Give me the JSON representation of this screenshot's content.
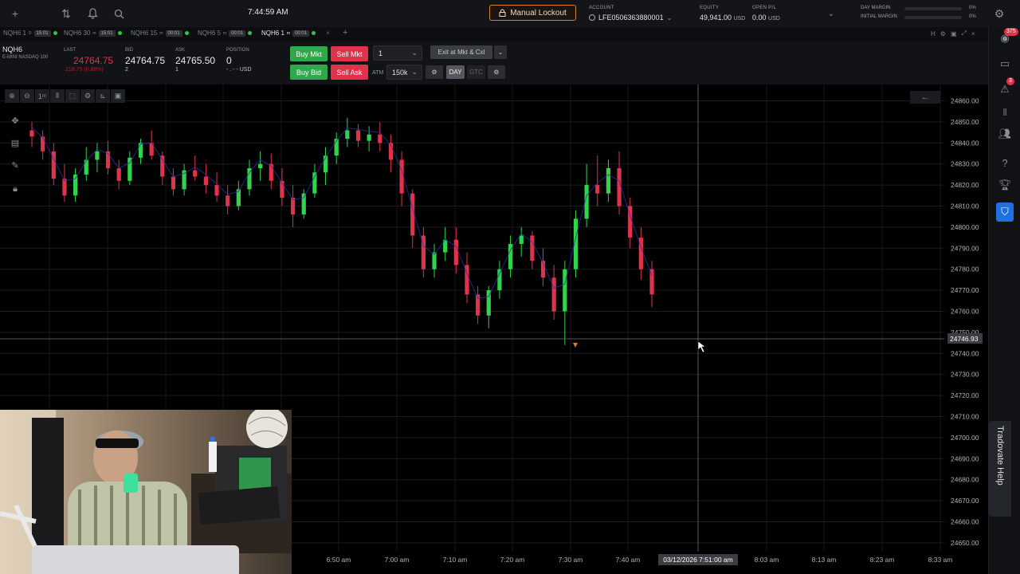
{
  "topbar": {
    "clock": "7:44:59 AM",
    "lockout_label": "Manual Lockout",
    "account_label": "ACCOUNT",
    "account_value": "LFE0506363880001",
    "equity_label": "EQUITY",
    "equity_value": "49,941.00",
    "equity_currency": "USD",
    "open_pl_label": "OPEN P/L",
    "open_pl_value": "0.00",
    "open_pl_currency": "USD",
    "day_margin_label": "DAY MARGIN",
    "day_margin_pct": "0%",
    "initial_margin_label": "INITIAL MARGIN",
    "initial_margin_pct": "0%"
  },
  "tabs": [
    {
      "label": "NQH6 1",
      "sup": "D",
      "tf": "15:01"
    },
    {
      "label": "NQH6 30",
      "sup": "m",
      "tf": "15:01"
    },
    {
      "label": "NQH6 15",
      "sup": "m",
      "tf": "00:01"
    },
    {
      "label": "NQH6 5",
      "sup": "m",
      "tf": "00:01"
    },
    {
      "label": "NQH6 1",
      "sup": "m",
      "tf": "00:01"
    }
  ],
  "quote": {
    "symbol": "NQH6",
    "description": "E-MINI NASDAQ 100",
    "last_label": "LAST",
    "last": "24764.75",
    "change": "218.75 (0.88%)",
    "bid_label": "BID",
    "bid": "24764.75",
    "bid_size": "2",
    "ask_label": "ASK",
    "ask": "24765.50",
    "ask_size": "1",
    "position_label": "POSITION",
    "position": "0",
    "position_sub": "- . - - USD"
  },
  "order": {
    "buy_mkt": "Buy Mkt",
    "sell_mkt": "Sell Mkt",
    "buy_bid": "Buy Bid",
    "sell_ask": "Sell Ask",
    "qty": "1",
    "atm_label": "ATM",
    "atm_value": "150k",
    "exit_label": "Exit at Mkt & Cxl",
    "day_label": "DAY",
    "gtc_label": "GTC"
  },
  "chart": {
    "crosshair_time": "03/12/2026 7:51:00 am",
    "crosshair_price": "24746.93",
    "x_ticks": [
      "6:50 am",
      "7:00 am",
      "7:10 am",
      "7:20 am",
      "7:30 am",
      "7:40 am",
      "8:03 am",
      "8:13 am",
      "8:23 am",
      "8:33 am"
    ],
    "y_ticks": [
      "24860.00",
      "24850.00",
      "24840.00",
      "24830.00",
      "24820.00",
      "24810.00",
      "24800.00",
      "24790.00",
      "24780.00",
      "24770.00",
      "24760.00",
      "24750.00",
      "24740.00",
      "24730.00",
      "24720.00",
      "24710.00",
      "24700.00",
      "24690.00",
      "24680.00",
      "24670.00",
      "24660.00",
      "24650.00"
    ]
  },
  "sidebar": {
    "badge_top": "375",
    "badge_alert": "3",
    "help_label": "Tradovate Help"
  },
  "colors": {
    "up": "#2fd44a",
    "down": "#e0324b",
    "accent": "#1f6fe0",
    "lockout_border": "#d9822b"
  }
}
